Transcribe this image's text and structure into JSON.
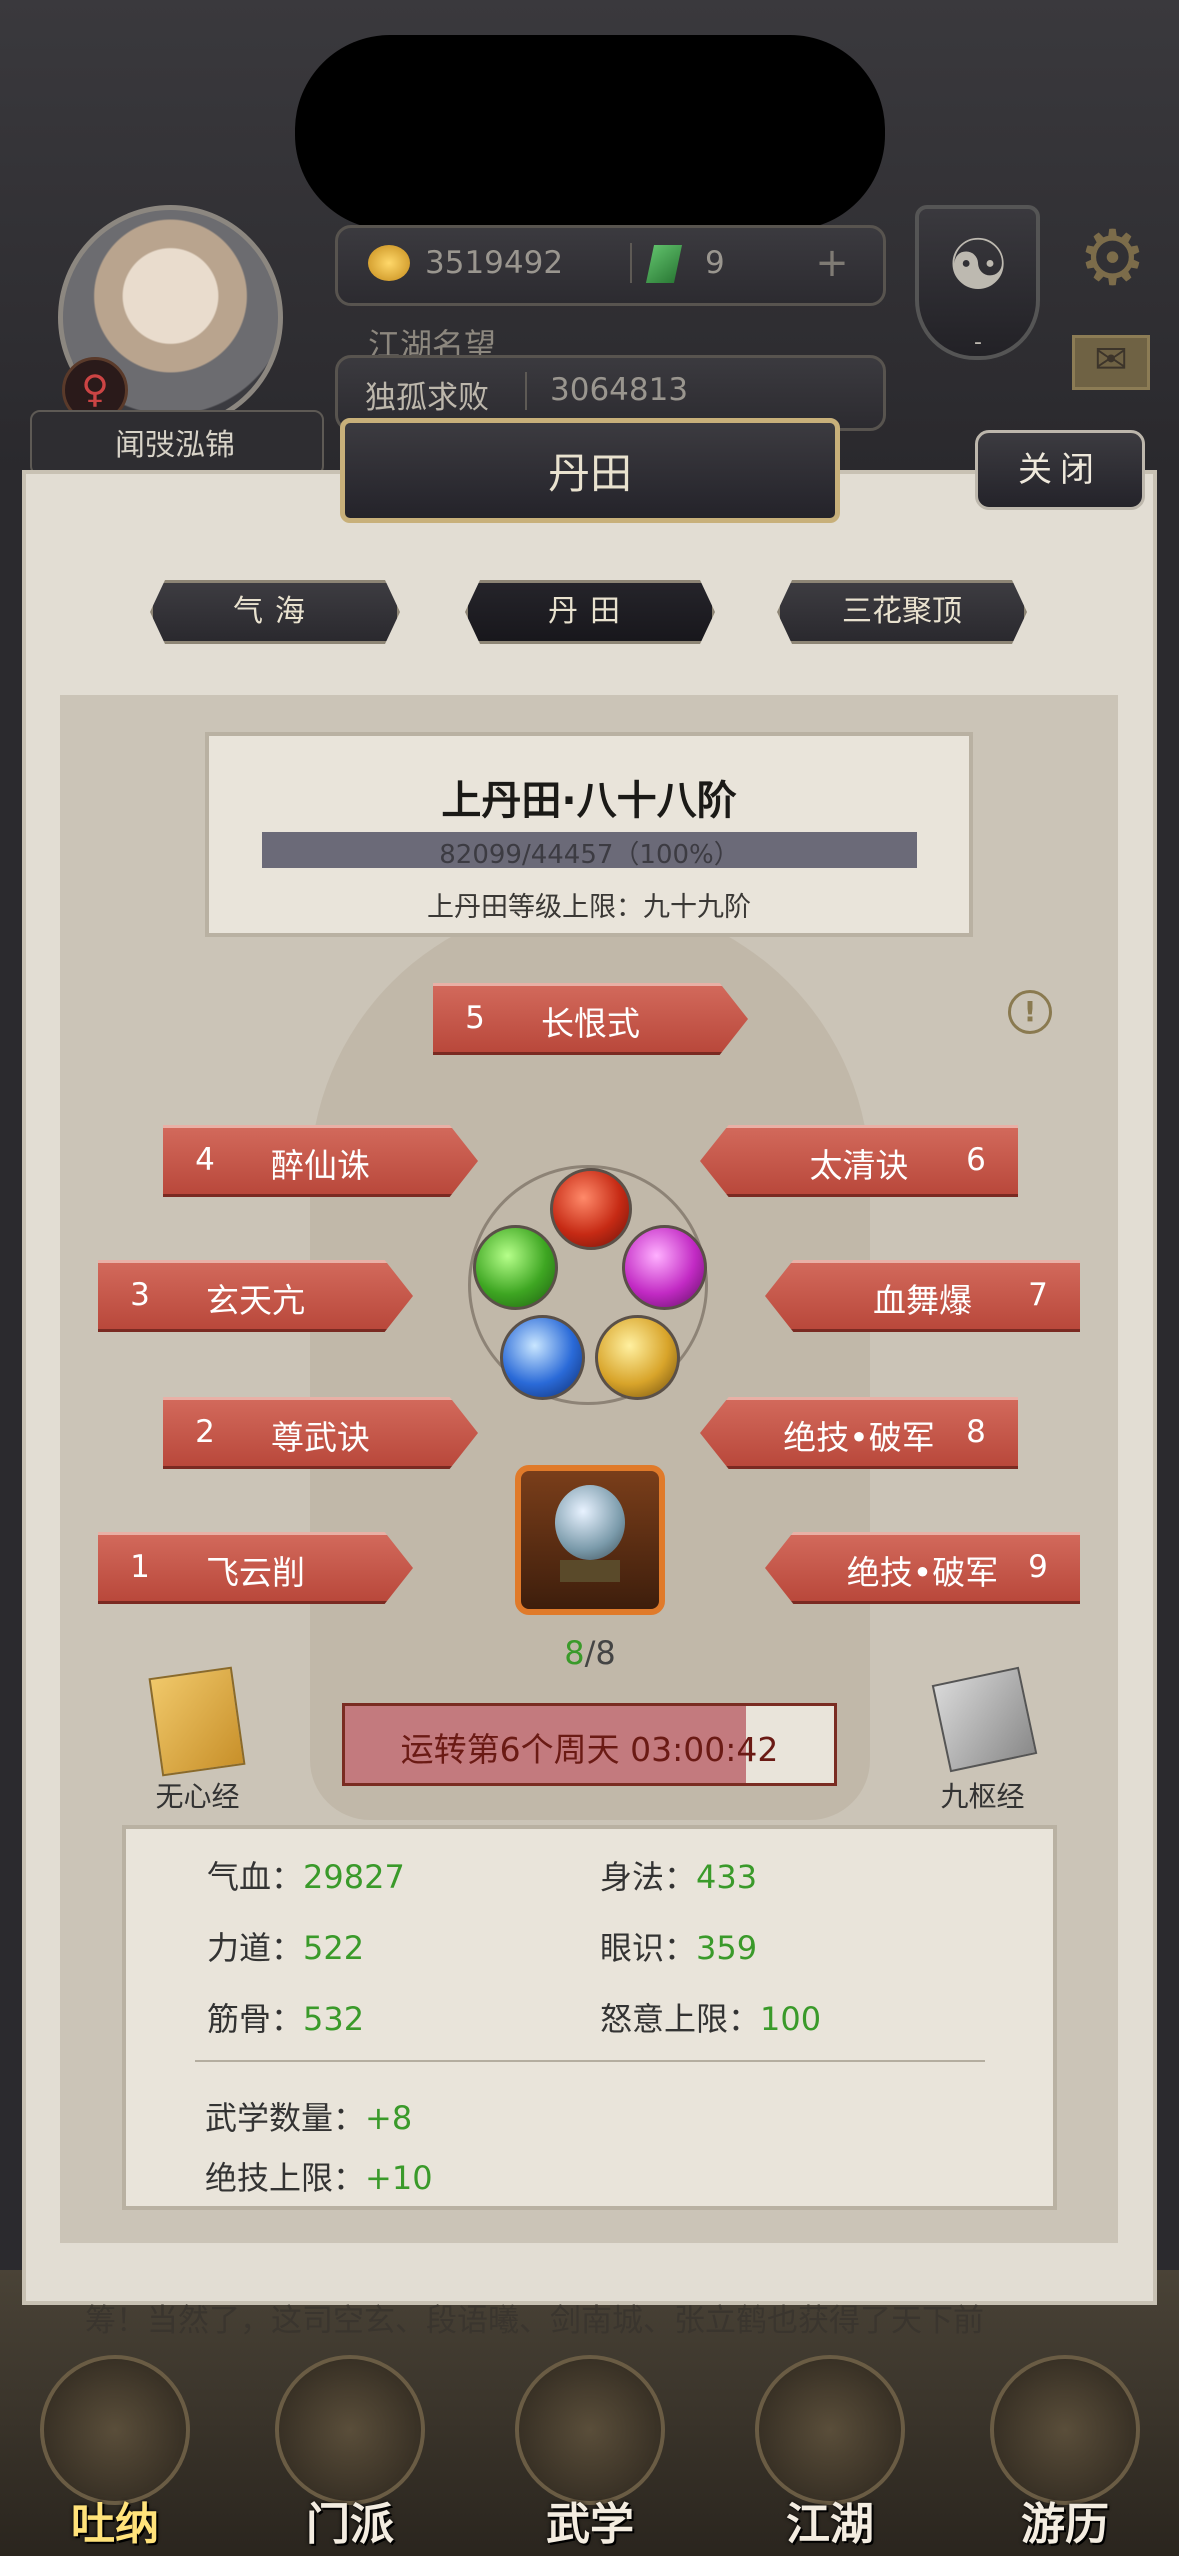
{
  "header": {
    "player_name": "闻弢泓锦",
    "gender_symbol": "♀",
    "gold": "3519492",
    "jade": "9",
    "plus": "+",
    "title_label": "江湖名望",
    "rank_name": "独孤求败",
    "power": "3064813",
    "taiji": "☯",
    "taiji_level": "-",
    "gear": "⚙",
    "mail": "✉"
  },
  "panel": {
    "title": "丹田",
    "close_label": "关闭",
    "tabs": [
      {
        "label": "气海"
      },
      {
        "label": "丹田"
      },
      {
        "label": "三花聚顶"
      }
    ],
    "active_tab": "丹田"
  },
  "level": {
    "title": "上丹田·八十八阶",
    "progress_text": "82099/44457（100%）",
    "progress_fraction": 1.0,
    "limit_text": "上丹田等级上限：九十九阶"
  },
  "skills": [
    {
      "num": "1",
      "name": "飞云削"
    },
    {
      "num": "2",
      "name": "尊武诀"
    },
    {
      "num": "3",
      "name": "玄天亢"
    },
    {
      "num": "4",
      "name": "醉仙诛"
    },
    {
      "num": "5",
      "name": "长恨式"
    },
    {
      "num": "6",
      "name": "太清诀"
    },
    {
      "num": "7",
      "name": "血舞爆"
    },
    {
      "num": "8",
      "name": "绝技•破军"
    },
    {
      "num": "9",
      "name": "绝技•破军"
    }
  ],
  "warning": "!",
  "capacity": {
    "current": "8",
    "sep": "/",
    "max": "8"
  },
  "books": {
    "left": "无心经",
    "right": "九枢经"
  },
  "cultivation": {
    "text": "运转第6个周天 03:00:42",
    "progress_fraction": 0.82
  },
  "stats": [
    {
      "label": "气血：",
      "value": "29827"
    },
    {
      "label": "身法：",
      "value": "433"
    },
    {
      "label": "力道：",
      "value": "522"
    },
    {
      "label": "眼识：",
      "value": "359"
    },
    {
      "label": "筋骨：",
      "value": "532"
    },
    {
      "label": "怒意上限：",
      "value": "100"
    }
  ],
  "bonuses": [
    {
      "label": "武学数量：",
      "value": "+8"
    },
    {
      "label": "绝技上限：",
      "value": "+10"
    }
  ],
  "marquee": "筹！当然了，这司空玄、段语曦、剑南城、张立鹤也获得了天下前",
  "nav": [
    {
      "label": "吐纳"
    },
    {
      "label": "门派"
    },
    {
      "label": "武学"
    },
    {
      "label": "江湖"
    },
    {
      "label": "游历"
    }
  ],
  "colors": {
    "ribbon": "#c4574a",
    "stat_value": "#3a9a2a",
    "progress": "#6b6a78",
    "accent_gold": "#c8b07a"
  }
}
